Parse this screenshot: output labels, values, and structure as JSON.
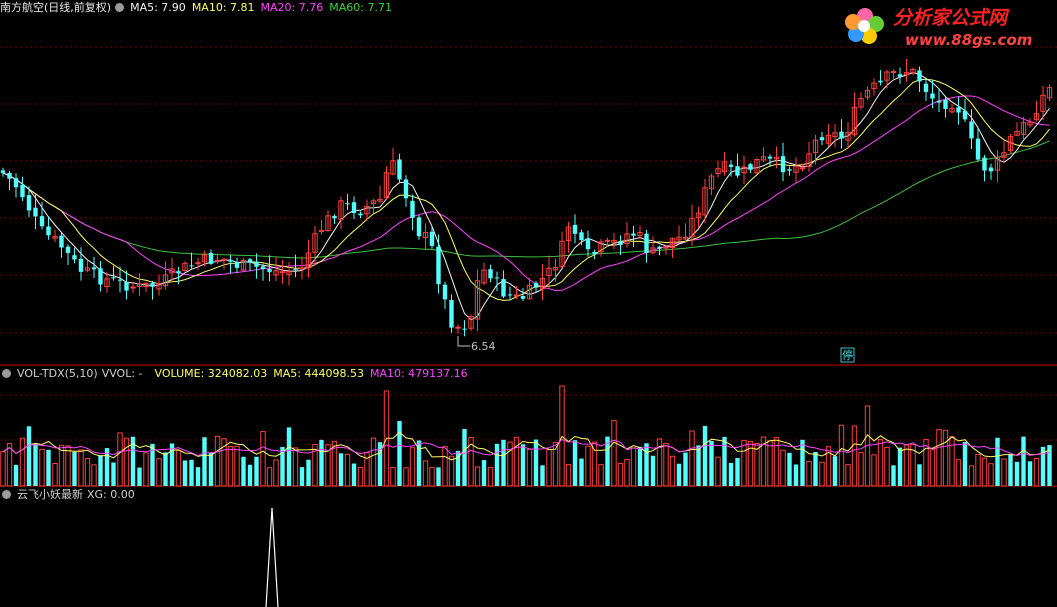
{
  "main_panel": {
    "title": "南方航空(日线,前复权)",
    "ma5": "MA5: 7.90",
    "ma10": "MA10: 7.81",
    "ma20": "MA20: 7.76",
    "ma60": "MA60: 7.71",
    "low_label": "6.54",
    "halt_marker": "停"
  },
  "volume_panel": {
    "indicator": "VOL-TDX(5,10)",
    "vvol": "VVOL: -",
    "volume": "VOLUME: 324082.03",
    "ma5": "MA5: 444098.53",
    "ma10": "MA10: 479137.16"
  },
  "signal_panel": {
    "name": "云飞小妖最新",
    "xg": "XG: 0.00"
  },
  "watermark": {
    "text": "分析家公式网",
    "url": "www.88gs.com"
  },
  "colors": {
    "background": "#000000",
    "up": "#ff4040",
    "down": "#54ffff",
    "ma5": "#f4f4f4",
    "ma10": "#ffff66",
    "ma20": "#ff44ff",
    "ma60": "#40c040",
    "separator": "#a00000"
  },
  "chart_data": {
    "type": "candlestick",
    "series": [
      {
        "name": "MA5",
        "value": 7.9
      },
      {
        "name": "MA10",
        "value": 7.81
      },
      {
        "name": "MA20",
        "value": 7.76
      },
      {
        "name": "MA60",
        "value": 7.71
      }
    ],
    "min_price": 6.54,
    "volume": 324082.03,
    "volume_ma5": 444098.53,
    "volume_ma10": 479137.16,
    "signal_xg": 0.0
  }
}
